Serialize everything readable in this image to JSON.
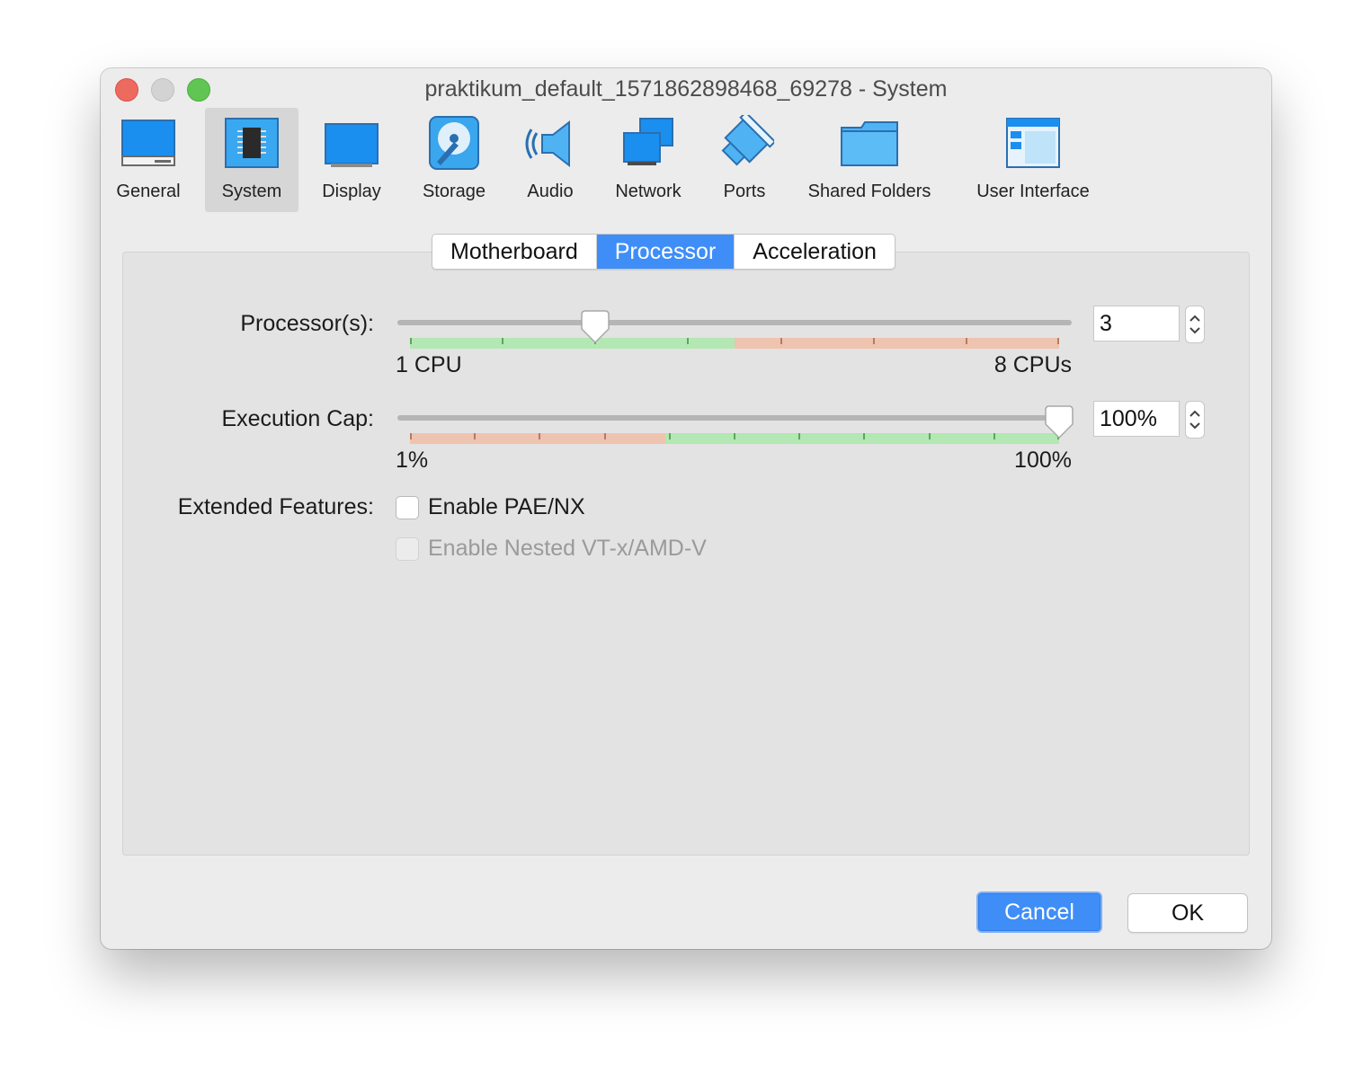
{
  "window": {
    "title": "praktikum_default_1571862898468_69278 - System"
  },
  "toolbar": {
    "items": [
      {
        "label": "General",
        "icon": "general-icon"
      },
      {
        "label": "System",
        "icon": "system-chip-icon",
        "selected": true
      },
      {
        "label": "Display",
        "icon": "display-icon"
      },
      {
        "label": "Storage",
        "icon": "storage-disk-icon"
      },
      {
        "label": "Audio",
        "icon": "audio-speaker-icon"
      },
      {
        "label": "Network",
        "icon": "network-icon"
      },
      {
        "label": "Ports",
        "icon": "ports-icon"
      },
      {
        "label": "Shared Folders",
        "icon": "shared-folder-icon"
      },
      {
        "label": "User Interface",
        "icon": "user-interface-icon"
      }
    ]
  },
  "tabs": [
    {
      "label": "Motherboard"
    },
    {
      "label": "Processor",
      "active": true
    },
    {
      "label": "Acceleration"
    }
  ],
  "processor": {
    "label": "Processor(s):",
    "value": "3",
    "min_label": "1 CPU",
    "max_label": "8 CPUs",
    "min": 1,
    "max": 8,
    "current": 3,
    "recommended_max": 4
  },
  "execution_cap": {
    "label": "Execution Cap:",
    "value": "100%",
    "min_label": "1%",
    "max_label": "100%",
    "min": 1,
    "max": 100,
    "current": 100,
    "recommended_min": 40
  },
  "extended_features": {
    "label": "Extended Features:",
    "pae_nx": {
      "label": "Enable PAE/NX",
      "checked": false,
      "enabled": true
    },
    "nested_vt": {
      "label": "Enable Nested VT-x/AMD-V",
      "checked": false,
      "enabled": false
    }
  },
  "buttons": {
    "cancel": "Cancel",
    "ok": "OK"
  },
  "colors": {
    "accent": "#3f8ef7",
    "scale_good": "#b3e7b3",
    "scale_bad": "#eec3b0"
  }
}
